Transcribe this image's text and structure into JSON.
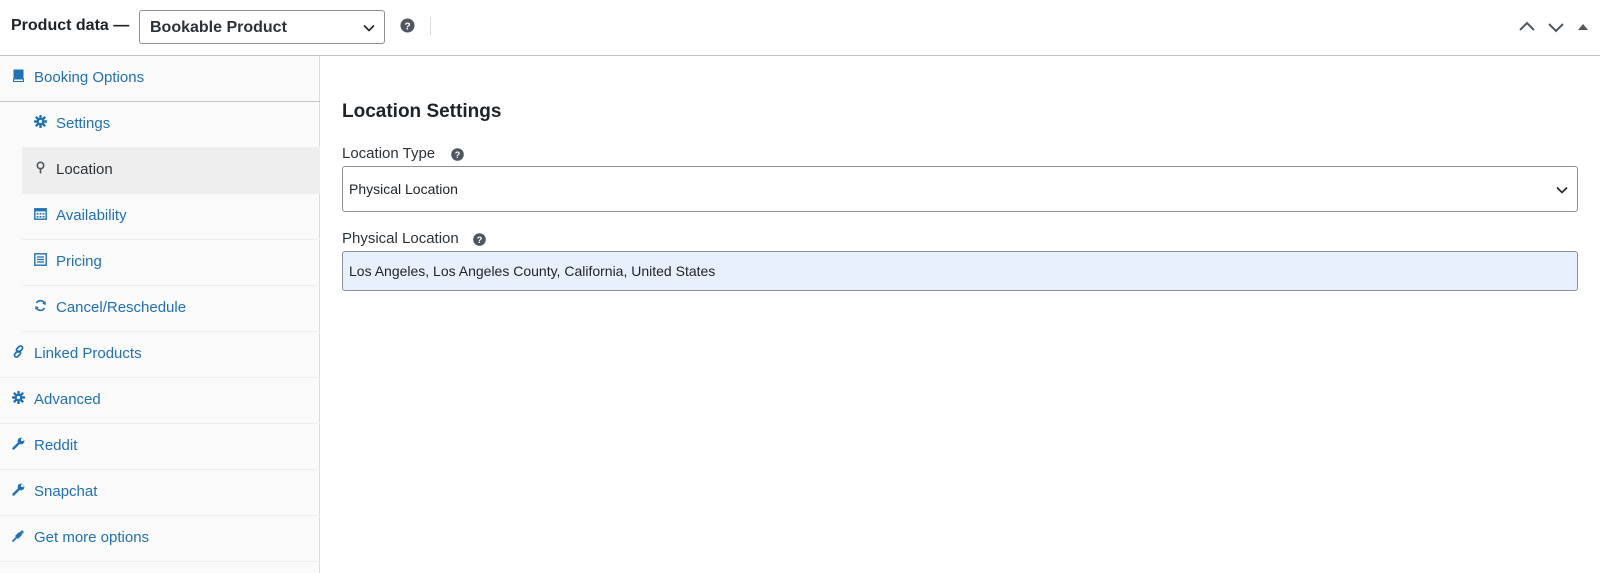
{
  "header": {
    "title": "Product data —",
    "product_type": {
      "selected": "Bookable Product"
    }
  },
  "sidebar": {
    "items": [
      {
        "label": "Booking Options",
        "icon": "book-icon"
      },
      {
        "label": "Settings",
        "icon": "gear-icon"
      },
      {
        "label": "Location",
        "icon": "location-pin-icon"
      },
      {
        "label": "Availability",
        "icon": "calendar-icon"
      },
      {
        "label": "Pricing",
        "icon": "list-icon"
      },
      {
        "label": "Cancel/Reschedule",
        "icon": "refresh-icon"
      },
      {
        "label": "Linked Products",
        "icon": "link-icon"
      },
      {
        "label": "Advanced",
        "icon": "gear-icon"
      },
      {
        "label": "Reddit",
        "icon": "wrench-icon"
      },
      {
        "label": "Snapchat",
        "icon": "wrench-icon"
      },
      {
        "label": "Get more options",
        "icon": "plugin-icon"
      }
    ],
    "active": "Location"
  },
  "main": {
    "section_title": "Location Settings",
    "location_type": {
      "label": "Location Type",
      "value": "Physical Location"
    },
    "physical_location": {
      "label": "Physical Location",
      "value": "Los Angeles, Los Angeles County, California, United States"
    }
  },
  "colors": {
    "link": "#2271b1",
    "active_bg": "#eeeeee",
    "autofill_bg": "#e8f0fe",
    "border": "#c3c4c7"
  }
}
